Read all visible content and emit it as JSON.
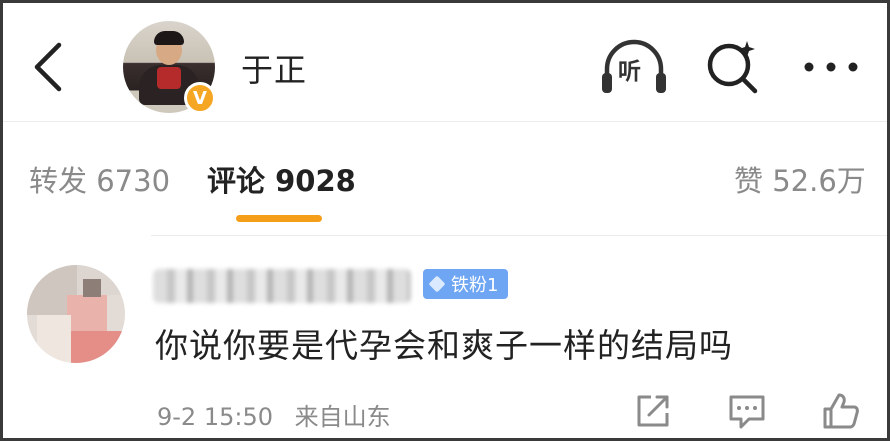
{
  "header": {
    "back_icon": "chevron-left-icon",
    "username": "于正",
    "verified_badge": "V",
    "listen_label": "听",
    "search_icon": "search-sparkle-icon",
    "more_icon": "more-dots-icon"
  },
  "tabs": {
    "repost": "转发 6730",
    "comment": "评论 9028",
    "like": "赞 52.6万",
    "active": "comment",
    "indicator_color": "#f59e1a"
  },
  "comment": {
    "fan_badge": "铁粉1",
    "text": "你说你要是代孕会和爽子一样的结局吗",
    "date": "9-2 15:50",
    "location": "来自山东",
    "actions": [
      "share-icon",
      "reply-icon",
      "like-icon"
    ]
  },
  "colors": {
    "badge_blue": "#6ea6f3",
    "verified_orange": "#f5a623",
    "muted_text": "#8a8a8a"
  }
}
